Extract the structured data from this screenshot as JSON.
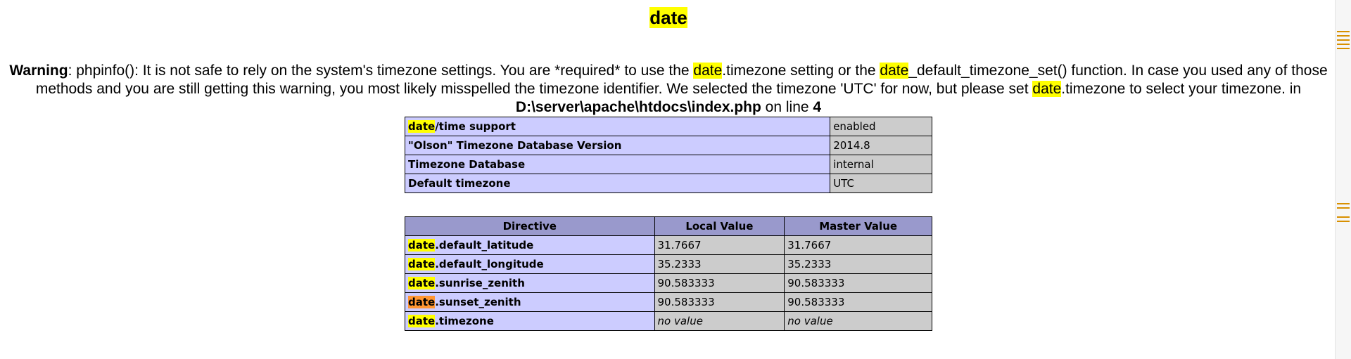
{
  "section_title": "date",
  "warning": {
    "label": "Warning",
    "msg_a": ": phpinfo(): It is not safe to rely on the system's timezone settings. You are *required* to use the ",
    "hl1": "date",
    "msg_b": ".timezone setting or the ",
    "hl2": "date",
    "msg_c": "_default_timezone_set() function. In case you used any of those methods and you are still getting this warning, you most likely misspelled the timezone identifier. We selected the timezone 'UTC' for now, but please set ",
    "hl3": "date",
    "msg_d": ".timezone to select your timezone. in ",
    "file": "D:\\server\\apache\\htdocs\\index.php",
    "on_line": " on line ",
    "line": "4"
  },
  "info_table": [
    {
      "hl": "date",
      "rest": "/time support",
      "value": "enabled"
    },
    {
      "hl": "",
      "rest": "\"Olson\" Timezone Database Version",
      "value": "2014.8"
    },
    {
      "hl": "",
      "rest": "Timezone Database",
      "value": "internal"
    },
    {
      "hl": "",
      "rest": "Default timezone",
      "value": "UTC"
    }
  ],
  "directives_table": {
    "headers": [
      "Directive",
      "Local Value",
      "Master Value"
    ],
    "rows": [
      {
        "hl": "date",
        "rest": ".default_latitude",
        "local": "31.7667",
        "master": "31.7667",
        "active": false
      },
      {
        "hl": "date",
        "rest": ".default_longitude",
        "local": "35.2333",
        "master": "35.2333",
        "active": false
      },
      {
        "hl": "date",
        "rest": ".sunrise_zenith",
        "local": "90.583333",
        "master": "90.583333",
        "active": false
      },
      {
        "hl": "date",
        "rest": ".sunset_zenith",
        "local": "90.583333",
        "master": "90.583333",
        "active": true
      },
      {
        "hl": "date",
        "rest": ".timezone",
        "local": "no value",
        "master": "no value",
        "active": false
      }
    ]
  },
  "colors": {
    "highlight": "#ffff00",
    "active_highlight": "#ff9632",
    "key_cell": "#ccccff",
    "value_cell": "#cccccc",
    "header_cell": "#9999cc"
  }
}
